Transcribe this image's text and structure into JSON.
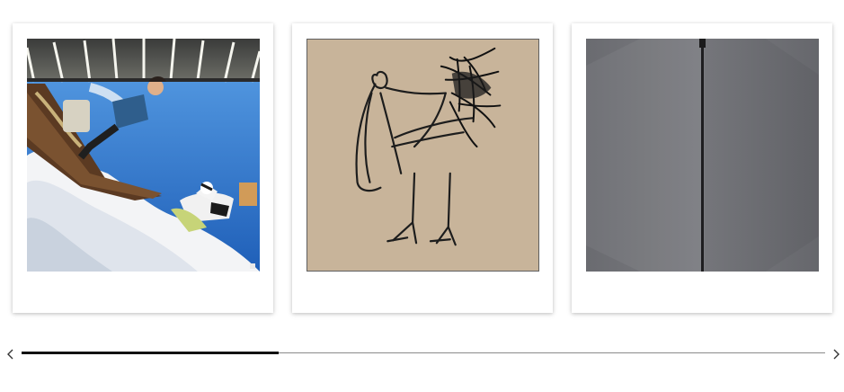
{
  "carousel": {
    "items": [
      {
        "icon": "surreal-painting-boat-cow-clouds"
      },
      {
        "icon": "bird-crayon-drawing"
      },
      {
        "icon": "grey-fabric-seam"
      }
    ],
    "prev_icon": "chevron-left-icon",
    "next_icon": "chevron-right-icon",
    "scroll_position": 0.32
  },
  "colors": {
    "sky": "#2f6fc4",
    "paper": "#c8b49a",
    "fabric": "#6c6c70",
    "thumb": "#111111",
    "track": "#8a8a8a"
  }
}
